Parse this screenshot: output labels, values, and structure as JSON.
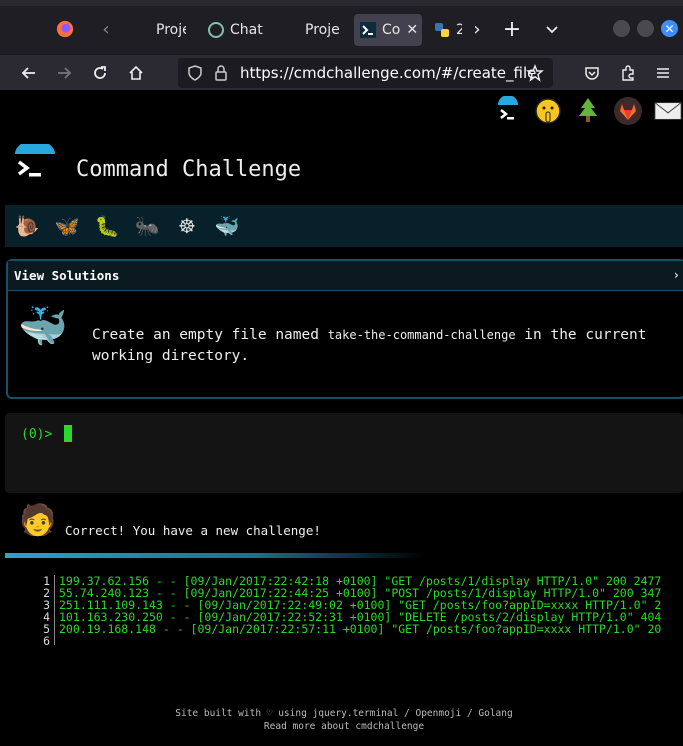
{
  "browser": {
    "tabs": [
      {
        "label": "Proje",
        "icon": "folder-icon"
      },
      {
        "label": "Chat",
        "icon": "chatgpt-icon"
      },
      {
        "label": "Proje",
        "icon": "folder-icon"
      },
      {
        "label": "Co",
        "icon": "terminal-icon",
        "active": true
      },
      {
        "label": "2",
        "icon": "python-icon"
      }
    ],
    "url": "https://cmdchallenge.com/#/create_file"
  },
  "site": {
    "title": "Command Challenge",
    "top_icons": [
      "terminal-icon",
      "shushing-face-icon",
      "tree-icon",
      "gitlab-icon",
      "envelope-icon"
    ],
    "emoji_bar": [
      "snail-icon",
      "butterfly-icon",
      "bug-icon",
      "ant-icon",
      "wheel-icon",
      "whale-icon"
    ],
    "solutions_header": "View Solutions",
    "task_text_before": "Create an empty file named ",
    "task_filename": "take-the-command-challenge",
    "task_text_after": " in the current working directory.",
    "prompt": "(0)>",
    "result_message": "Correct! You have a new challenge!",
    "log_lines": [
      {
        "n": "1",
        "text": "199.37.62.156 - - [09/Jan/2017:22:42:18 +0100] \"GET /posts/1/display HTTP/1.0\" 200 2477"
      },
      {
        "n": "2",
        "text": "55.74.240.123 - - [09/Jan/2017:22:44:25 +0100] \"POST /posts/1/display HTTP/1.0\" 200 347"
      },
      {
        "n": "3",
        "text": "251.111.109.143 - - [09/Jan/2017:22:49:02 +0100] \"GET /posts/foo?appID=xxxx HTTP/1.0\" 2"
      },
      {
        "n": "4",
        "text": "101.163.230.250 - - [09/Jan/2017:22:52:31 +0100] \"DELETE /posts/2/display HTTP/1.0\" 404"
      },
      {
        "n": "5",
        "text": "200.19.168.148 - - [09/Jan/2017:22:57:11 +0100] \"GET /posts/foo?appID=xxxx HTTP/1.0\" 20"
      },
      {
        "n": "6",
        "text": ""
      }
    ],
    "footer_line1": "Site built with ♡ using jquery.terminal / Openmoji / Golang",
    "footer_line2": "Read more about cmdchallenge"
  }
}
